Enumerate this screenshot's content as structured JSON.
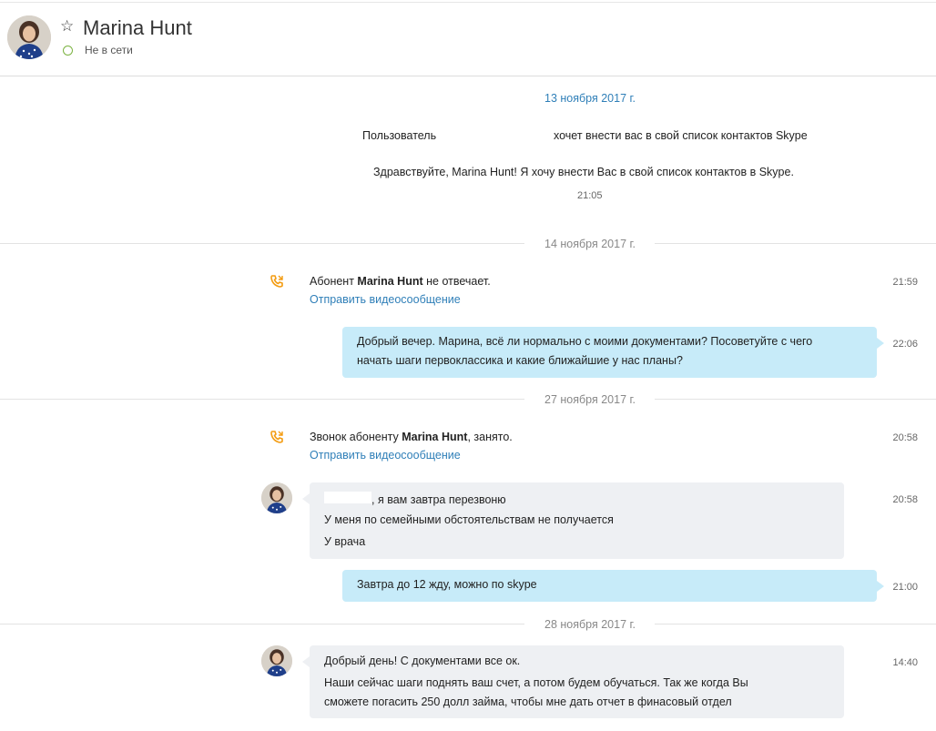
{
  "header": {
    "name": "Marina Hunt",
    "status": "Не в сети"
  },
  "colors": {
    "accent": "#2f7fb8",
    "outgoing_bubble": "#c7ebf9",
    "incoming_bubble": "#eef0f3",
    "call_icon": "#f39c12",
    "status_offline": "#7cb342"
  },
  "groups": [
    {
      "date": "13 ноября 2017 г.",
      "contact_request": {
        "prefix": "Пользователь",
        "suffix": "хочет внести вас в свой список контактов Skype",
        "message": "Здравствуйте, Marina Hunt! Я хочу внести Вас в свой список контактов в Skype.",
        "time": "21:05"
      }
    },
    {
      "date": "14 ноября 2017 г.",
      "call": {
        "pre": "Абонент ",
        "name": "Marina Hunt",
        "post": " не отвечает.",
        "link": "Отправить видеосообщение",
        "time": "21:59",
        "icon": "phone-missed-icon"
      },
      "outgoing": {
        "lines": [
          "Добрый вечер. Марина, всё ли нормально с моими документами? Посоветуйте с чего",
          "начать шаги первоклассика и какие ближайшие у нас планы?"
        ],
        "time": "22:06"
      }
    },
    {
      "date": "27 ноября 2017 г.",
      "call": {
        "pre": "Звонок абоненту ",
        "name": "Marina Hunt",
        "post": ", занято.",
        "link": "Отправить видеосообщение",
        "time": "20:58",
        "icon": "phone-busy-icon"
      },
      "incoming": {
        "lines": [
          ", я вам завтра перезвоню",
          "У меня по семейными обстоятельствам не получается",
          "У врача"
        ],
        "time": "20:58"
      },
      "outgoing": {
        "lines": [
          "Завтра до 12 жду, можно по skype"
        ],
        "time": "21:00"
      }
    },
    {
      "date": "28 ноября 2017 г.",
      "incoming": {
        "lines": [
          "Добрый день! С документами все ок.",
          "Наши сейчас шаги поднять ваш счет, а потом будем обучаться. Так же когда Вы",
          "сможете погасить 250 долл займа, чтобы мне дать отчет в финасовый отдел"
        ],
        "time": "14:40"
      }
    }
  ]
}
